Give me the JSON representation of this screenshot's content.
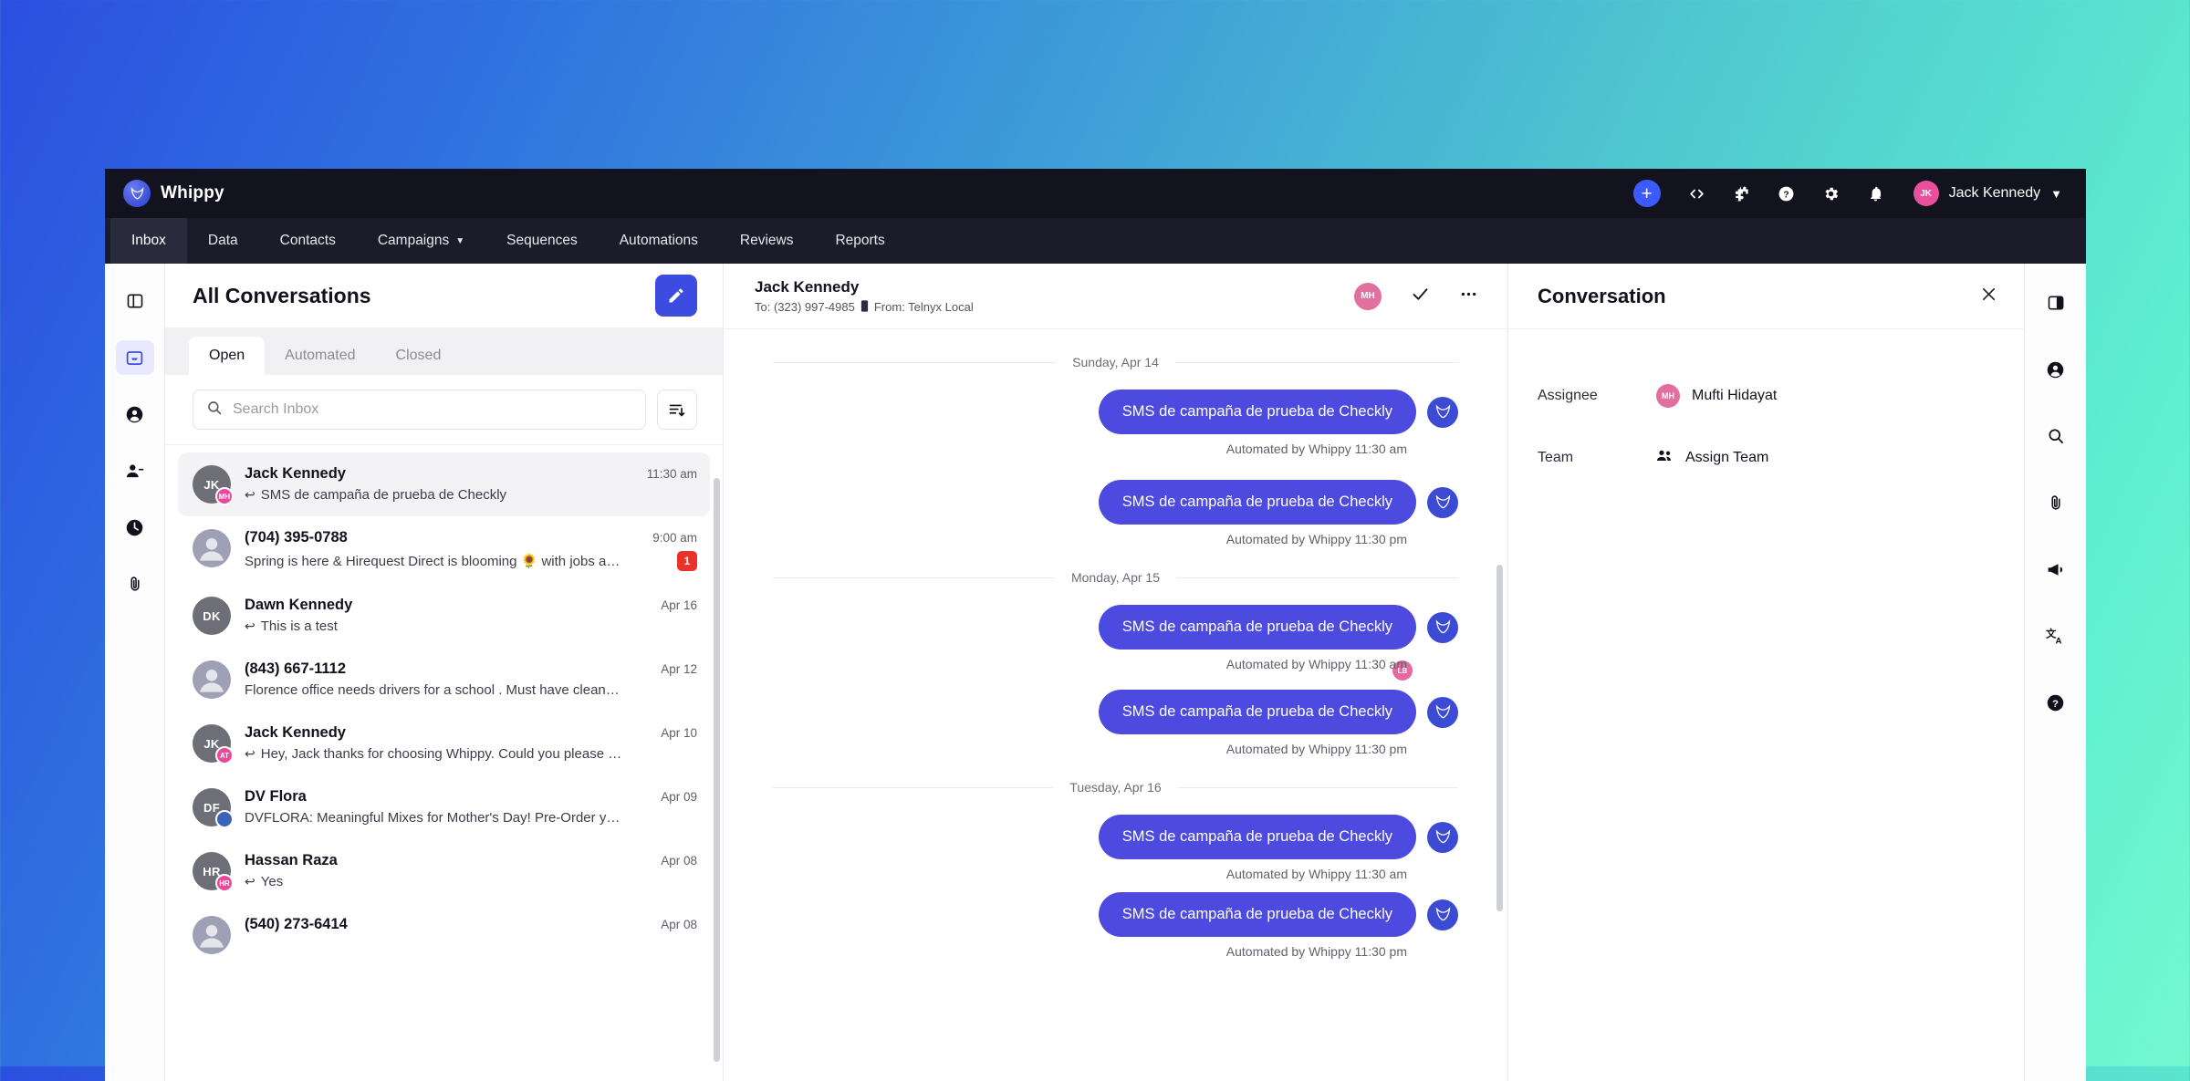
{
  "brand": {
    "name": "Whippy",
    "logo_icon": "whippy-logo-icon"
  },
  "topbar": {
    "add_icon": "plus-icon",
    "code_icon": "code-brackets-icon",
    "puzzle_icon": "puzzle-piece-icon",
    "help_icon": "help-circle-icon",
    "settings_icon": "gear-icon",
    "notifications_icon": "bell-icon",
    "user": {
      "name": "Jack Kennedy",
      "initials": "JK",
      "caret_icon": "chevron-down-icon"
    }
  },
  "nav": {
    "items": [
      {
        "label": "Inbox",
        "active": true,
        "has_caret": false
      },
      {
        "label": "Data",
        "active": false,
        "has_caret": false
      },
      {
        "label": "Contacts",
        "active": false,
        "has_caret": false
      },
      {
        "label": "Campaigns",
        "active": false,
        "has_caret": true
      },
      {
        "label": "Sequences",
        "active": false,
        "has_caret": false
      },
      {
        "label": "Automations",
        "active": false,
        "has_caret": false
      },
      {
        "label": "Reviews",
        "active": false,
        "has_caret": false
      },
      {
        "label": "Reports",
        "active": false,
        "has_caret": false
      }
    ]
  },
  "left_rail": {
    "items": [
      {
        "icon": "panel-layout-icon",
        "active": false
      },
      {
        "icon": "inbox-icon",
        "active": true
      },
      {
        "icon": "user-circle-icon",
        "active": false
      },
      {
        "icon": "user-minus-icon",
        "active": false
      },
      {
        "icon": "clock-icon",
        "active": false
      },
      {
        "icon": "paperclip-icon",
        "active": false
      }
    ]
  },
  "list": {
    "title": "All Conversations",
    "compose_icon": "pencil-icon",
    "tabs": [
      {
        "label": "Open",
        "active": true
      },
      {
        "label": "Automated",
        "active": false
      },
      {
        "label": "Closed",
        "active": false
      }
    ],
    "search": {
      "placeholder": "Search Inbox",
      "value": "",
      "icon": "search-icon"
    },
    "filter_icon": "sort-filter-icon",
    "conversations": [
      {
        "name": "Jack Kennedy",
        "initials": "JK",
        "avatar_color": "#6e6e76",
        "badge_initials": "MH",
        "badge_color": "#e9489b",
        "preview": "SMS de campaña de prueba de Checkly",
        "has_reply_arrow": true,
        "time": "11:30 am",
        "unread": "",
        "selected": true
      },
      {
        "name": "(704) 395-0788",
        "initials": "",
        "avatar_color": "",
        "badge_initials": "",
        "badge_color": "",
        "preview": "Spring is here & Hirequest Direct is blooming 🌻 with jobs a…",
        "has_reply_arrow": false,
        "time": "9:00 am",
        "unread": "1",
        "selected": false
      },
      {
        "name": "Dawn Kennedy",
        "initials": "DK",
        "avatar_color": "#6e6e76",
        "badge_initials": "",
        "badge_color": "",
        "preview": "This is a test",
        "has_reply_arrow": true,
        "time": "Apr 16",
        "unread": "",
        "selected": false
      },
      {
        "name": "(843) 667-1112",
        "initials": "",
        "avatar_color": "",
        "badge_initials": "",
        "badge_color": "",
        "preview": "Florence office needs drivers for a school . Must have clean…",
        "has_reply_arrow": false,
        "time": "Apr 12",
        "unread": "",
        "selected": false
      },
      {
        "name": "Jack Kennedy",
        "initials": "JK",
        "avatar_color": "#6e6e76",
        "badge_initials": "AT",
        "badge_color": "#e9489b",
        "preview": "Hey, Jack thanks for choosing Whippy. Could you please …",
        "has_reply_arrow": true,
        "time": "Apr 10",
        "unread": "",
        "selected": false
      },
      {
        "name": "DV Flora",
        "initials": "DF",
        "avatar_color": "#6e6e76",
        "badge_initials": "",
        "badge_color": "#3b63b8",
        "preview": "DVFLORA: Meaningful Mixes for Mother's Day! Pre-Order y…",
        "has_reply_arrow": false,
        "time": "Apr 09",
        "unread": "",
        "selected": false
      },
      {
        "name": "Hassan Raza",
        "initials": "HR",
        "avatar_color": "#6e6e76",
        "badge_initials": "HR",
        "badge_color": "#e9489b",
        "preview": "Yes",
        "has_reply_arrow": true,
        "time": "Apr 08",
        "unread": "",
        "selected": false
      },
      {
        "name": "(540) 273-6414",
        "initials": "",
        "avatar_color": "",
        "badge_initials": "",
        "badge_color": "",
        "preview": "",
        "has_reply_arrow": false,
        "time": "Apr 08",
        "unread": "",
        "selected": false
      }
    ]
  },
  "thread": {
    "contact_name": "Jack Kennedy",
    "to_label": "To: (323) 997-4985",
    "from_label": "From: Telnyx Local",
    "phone_icon": "mobile-phone-icon",
    "assignee_initials": "MH",
    "resolve_icon": "check-icon",
    "more_icon": "ellipsis-icon",
    "groups": [
      {
        "date": "Sunday, Apr 14",
        "messages": [
          {
            "text": "SMS de campaña de prueba de Checkly",
            "meta": "Automated by Whippy",
            "time": "11:30 am",
            "reaction": ""
          },
          {
            "text": "SMS de campaña de prueba de Checkly",
            "meta": "Automated by Whippy",
            "time": "11:30 pm",
            "reaction": ""
          }
        ]
      },
      {
        "date": "Monday, Apr 15",
        "messages": [
          {
            "text": "SMS de campaña de prueba de Checkly",
            "meta": "Automated by Whippy",
            "time": "11:30 am",
            "reaction": "LB"
          },
          {
            "text": "SMS de campaña de prueba de Checkly",
            "meta": "Automated by Whippy",
            "time": "11:30 pm",
            "reaction": ""
          }
        ]
      },
      {
        "date": "Tuesday, Apr 16",
        "messages": [
          {
            "text": "SMS de campaña de prueba de Checkly",
            "meta": "Automated by Whippy",
            "time": "11:30 am",
            "reaction": ""
          },
          {
            "text": "SMS de campaña de prueba de Checkly",
            "meta": "Automated by Whippy",
            "time": "11:30 pm",
            "reaction": ""
          }
        ]
      }
    ]
  },
  "right_panel": {
    "title": "Conversation",
    "close_icon": "close-icon",
    "assignee_label": "Assignee",
    "assignee_name": "Mufti Hidayat",
    "assignee_initials": "MH",
    "team_label": "Team",
    "team_value": "Assign Team",
    "team_icon": "people-icon"
  },
  "right_rail": {
    "items": [
      {
        "icon": "panel-right-icon"
      },
      {
        "icon": "user-circle-icon"
      },
      {
        "icon": "search-icon"
      },
      {
        "icon": "paperclip-icon"
      },
      {
        "icon": "megaphone-icon"
      },
      {
        "icon": "translate-icon"
      },
      {
        "icon": "help-circle-icon"
      }
    ]
  },
  "colors": {
    "accent": "#3d4ce0",
    "bubble": "#4d4ae0",
    "unread_badge": "#e8322a",
    "avatar_pink": "#e9489b",
    "topbar": "#13131f",
    "navbar": "#1b1b2a"
  }
}
